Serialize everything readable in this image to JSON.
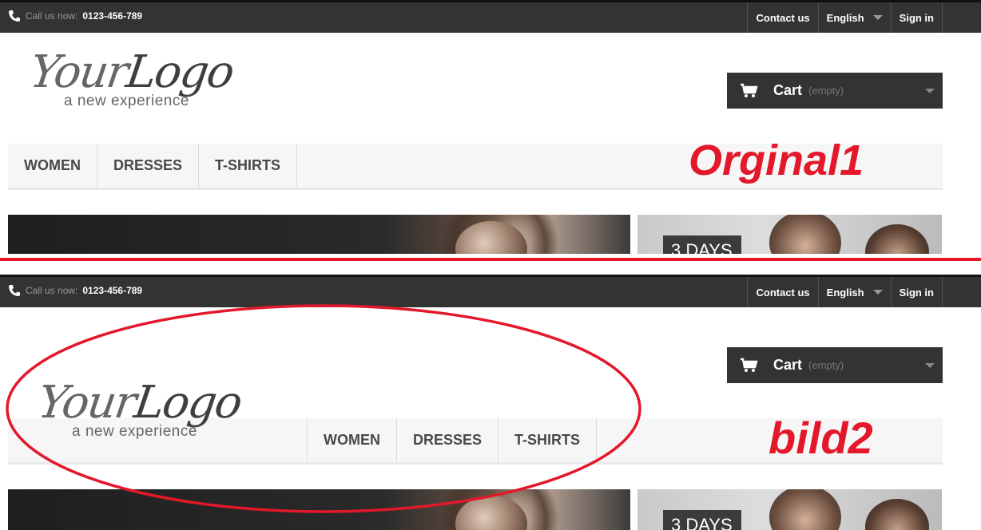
{
  "topbar": {
    "call_label": "Call us now:",
    "phone_number": "0123-456-789",
    "nav": {
      "contact": "Contact us",
      "language": "English",
      "signin": "Sign in"
    }
  },
  "logo": {
    "script_your": "Your",
    "script_logo": "Logo",
    "tagline": "a new experience"
  },
  "cart": {
    "label": "Cart",
    "status": "(empty)"
  },
  "menu": {
    "items": [
      "WOMEN",
      "DRESSES",
      "T-SHIRTS"
    ]
  },
  "banner": {
    "promo": "3 DAYS"
  },
  "annotations": {
    "panel1": "Orginal1",
    "panel2": "bild2"
  },
  "colors": {
    "annotation_red": "#e3182a",
    "topbar_bg": "#333333",
    "menu_bg": "#f6f6f6"
  },
  "icons": [
    "phone-icon",
    "cart-icon",
    "chevron-down-icon"
  ]
}
